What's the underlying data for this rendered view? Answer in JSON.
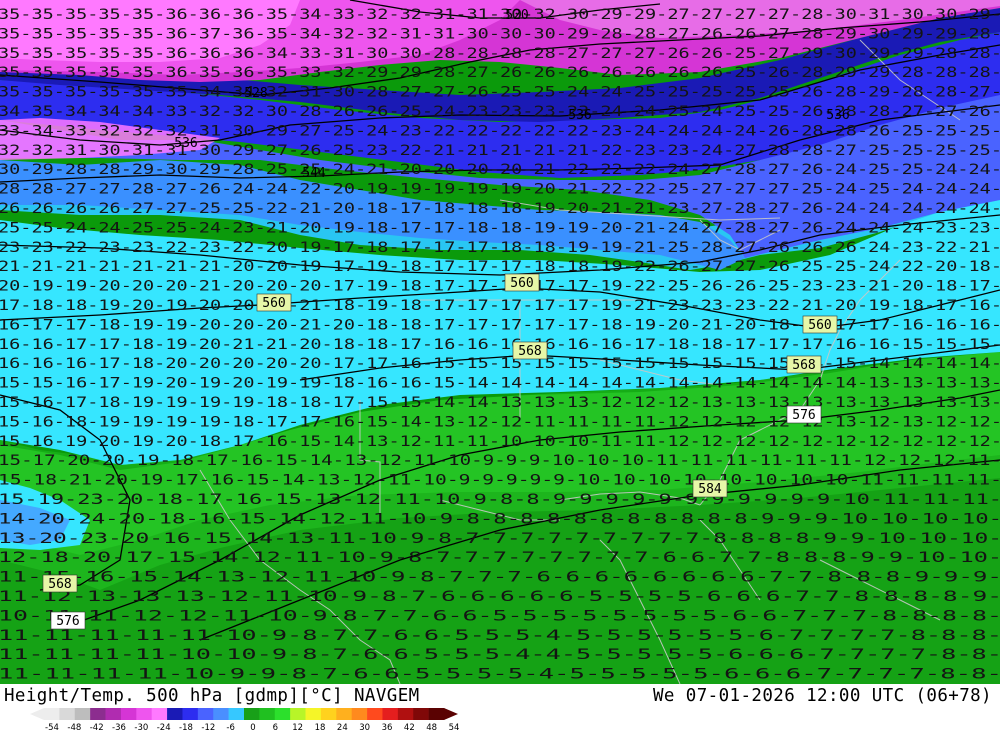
{
  "footer": {
    "title": "Height/Temp. 500 hPa [gdmp][°C] NAVGEM",
    "datetime": "We 07-01-2026 12:00 UTC (06+78)"
  },
  "colorbar": {
    "ticks": [
      "-54",
      "-48",
      "-42",
      "-36",
      "-30",
      "-24",
      "-18",
      "-12",
      "-6",
      "0",
      "6",
      "12",
      "18",
      "24",
      "30",
      "36",
      "42",
      "48",
      "54"
    ],
    "colors": [
      "#ededed",
      "#d9d9d9",
      "#bdbdbd",
      "#8c2d8f",
      "#b02cb0",
      "#d535d5",
      "#ee55ee",
      "#ff79ff",
      "#1a1ab5",
      "#2d2df0",
      "#4a63ff",
      "#4a8fff",
      "#36c8ff",
      "#18a018",
      "#20c020",
      "#2ce02c",
      "#b8f528",
      "#f5f528",
      "#ffd21e",
      "#ffb01e",
      "#ff8a1e",
      "#ff4a1e",
      "#e51e1e",
      "#b01010",
      "#800808",
      "#5a0202"
    ]
  },
  "contour_labels": [
    {
      "text": "520"
    },
    {
      "text": "528"
    },
    {
      "text": "536"
    },
    {
      "text": "544"
    },
    {
      "text": "552"
    },
    {
      "text": "560"
    },
    {
      "text": "568"
    },
    {
      "text": "576"
    },
    {
      "text": "584"
    }
  ],
  "temperature_rows": [
    "35-35-35-35-35-36-36-36-35-34-33-32-32-31-31-30-32-30-29-29-27-27-27-27-28-30-31-30-30-29-",
    "35-35-35-35-35-36-37-36-35-34-32-32-31-31-30-30-30-29-28-28-27-26-26-27-28-29-30-29-29-28-",
    "35-35-35-35-35-36-36-36-34-33-31-30-30-28-28-28-28-27-27-27-26-26-25-27-29-30-29-29-28-28-",
    "35-35-35-35-35-36-35-36-35-33-32-29-29-28-27-26-26-26-26-26-26-26-25-26-28-29-29-28-28-28-",
    "35-35-35-35-35-35-34-34-32-31-30-28-27-27-26-25-25-24-24-25-25-25-25-25-26-28-29-28-28-27-",
    "34-35-34-34-34-33-32-32-30-28-26-26-25-24-23-23-23-23-24-24-25-24-25-25-26-28-28-27-27-26-",
    "33-34-33-32-32-32-31-30-29-27-25-24-23-22-22-22-22-22-23-24-24-24-24-26-28-28-26-25-25-25-",
    "32-32-31-30-31-31-30-29-27-26-25-23-22-21-21-21-21-21-22-23-23-24-27-28-28-27-25-25-25-25-",
    "30-29-28-28-29-30-29-28-25-25-24-21-20-20-20-20-21-22-22-22-24-27-28-27-26-24-25-25-24-24-",
    "28-28-27-27-28-27-26-24-24-22-20-19-19-19-19-19-20-21-22-22-25-27-27-27-25-24-25-24-24-24-",
    "26-26-26-26-27-27-25-25-22-21-20-18-17-18-18-18-19-20-21-21-23-27-28-27-26-24-24-24-24-24-",
    "25-25-24-24-25-25-24-23-21-20-19-18-17-17-18-18-19-19-20-21-24-27-28-27-26-24-24-24-23-23-",
    "23-23-22-23-23-22-23-22-20-19-17-18-17-17-17-18-18-19-19-21-25-28-27-26-26-26-24-23-22-21-",
    "21-21-21-21-21-21-21-20-20-19-17-19-18-17-17-17-18-18-19-22-26-27-27-26-25-25-24-22-20-18-",
    "20-19-19-20-20-20-21-20-20-20-17-19-18-17-17-18-17-17-19-22-25-26-26-25-23-23-21-20-18-17-",
    "17-18-18-19-20-19-20-20-20-21-18-19-18-17-17-17-17-17-19-21-23-23-23-22-21-20-19-18-17-16-",
    "16-17-17-18-19-19-20-20-20-21-20-18-18-17-17-17-17-17-18-19-20-21-20-18-18-17-17-16-16-16-",
    "16-16-17-17-18-19-20-21-21-20-18-18-17-16-16-16-16-16-16-17-18-18-17-17-17-16-16-15-15-15-",
    "16-16-16-17-18-20-20-20-20-20-17-17-16-15-15-15-15-15-15-15-15-15-15-15-14-15-14-14-14-14-",
    "15-15-16-17-19-20-19-20-19-19-18-16-16-15-14-14-14-14-14-14-14-14-14-14-14-14-13-13-13-13-",
    "15-16-17-18-19-19-19-19-18-18-17-15-15-14-14-13-13-13-12-12-12-13-13-13-13-13-13-13-13-13-",
    "15-16-18-19-19-19-19-18-17-17-16-15-14-13-12-12-11-11-11-11-12-12-12-12-12-13-12-13-12-12-",
    "15-16-19-20-19-20-18-17-16-15-14-13-12-11-11-10-10-10-11-11-12-12-12-12-12-12-12-12-12-12-",
    "15-17-20-20-19-18-17-16-15-14-13-12-11-10-9-9-9-10-10-10-11-11-11-11-11-11-12-12-12-11-",
    "15-18-21-20-19-17-16-15-14-13-12-11-10-9-9-9-9-9-10-10-10-10-10-10-10-10-11-11-11-11-",
    "15-19-23-20-18-17-16-15-13-12-11-10-9-8-8-9-9-9-9-9-9-9-9-9-9-9-10-11-11-11-",
    "14-20-24-20-18-16-15-14-12-11-10-9-8-8-8-8-8-8-8-8-8-8-8-9-9-9-10-10-10-10-",
    "13-20-23-20-16-15-14-13-11-10-9-8-7-7-7-7-7-7-7-7-7-8-8-8-8-9-9-10-10-10-",
    "12-18-20-17-15-14-12-11-10-9-8-7-7-7-7-7-7-7-7-6-6-7-7-8-8-8-9-9-10-10-",
    "11-15-16-15-14-13-12-11-10-9-8-7-7-7-6-6-6-6-6-6-6-6-7-7-8-8-8-9-9-9-",
    "11-12-13-13-13-12-11-10-9-8-7-6-6-6-6-6-5-5-5-5-6-6-6-7-7-8-8-8-8-9-",
    "10-11-11-12-12-11-10-9-8-7-7-6-6-5-5-5-5-5-5-5-5-6-6-7-7-7-8-8-8-8-",
    "11-11-11-11-11-10-9-8-7-7-6-6-5-5-5-4-5-5-5-5-5-5-6-7-7-7-7-8-8-8-",
    "11-11-11-11-10-10-9-8-7-6-6-5-5-5-4-4-5-5-5-5-5-6-6-6-7-7-7-7-8-8-",
    "11-11-11-11-10-9-9-8-7-6-6-5-5-5-5-4-5-5-5-5-5-6-6-6-7-7-7-7-8-8-"
  ]
}
